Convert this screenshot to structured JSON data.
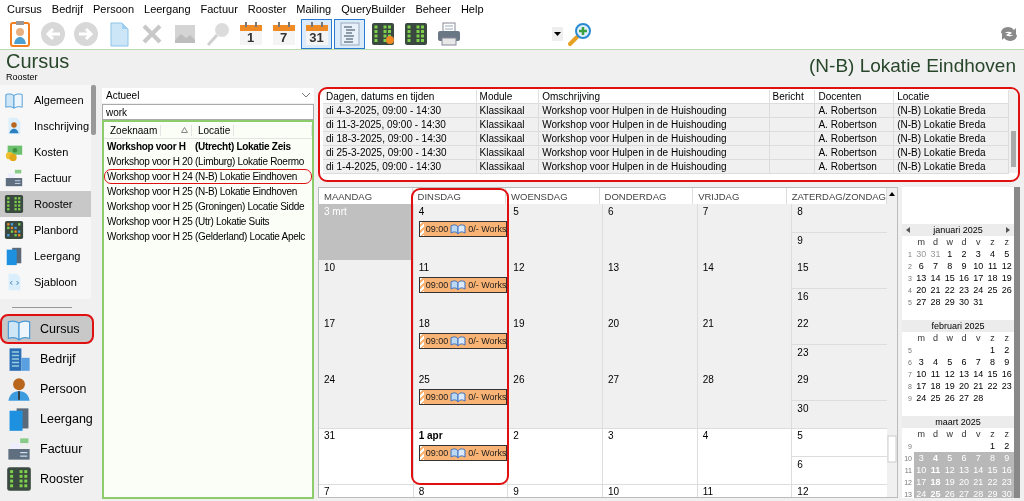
{
  "menu": [
    "Cursus",
    "Bedrijf",
    "Persoon",
    "Leergang",
    "Factuur",
    "Rooster",
    "Mailing",
    "QueryBuilder",
    "Beheer",
    "Help"
  ],
  "toolbar": [
    {
      "kind": "person",
      "disabled": false,
      "selected": false
    },
    {
      "kind": "back",
      "disabled": true,
      "selected": false
    },
    {
      "kind": "forward",
      "disabled": true,
      "selected": false
    },
    {
      "kind": "document",
      "disabled": false,
      "selected": false
    },
    {
      "kind": "delete",
      "disabled": true,
      "selected": false
    },
    {
      "kind": "picture",
      "disabled": true,
      "selected": false
    },
    {
      "kind": "pin",
      "disabled": true,
      "selected": false
    },
    {
      "kind": "calendar",
      "label": "1",
      "disabled": false,
      "selected": false
    },
    {
      "kind": "calendar",
      "label": "7",
      "disabled": false,
      "selected": false
    },
    {
      "kind": "calendar",
      "label": "31",
      "disabled": false,
      "selected": true
    },
    {
      "kind": "list",
      "disabled": false,
      "selected": true
    },
    {
      "kind": "grid-dot",
      "disabled": false,
      "selected": false
    },
    {
      "kind": "grid",
      "disabled": false,
      "selected": false
    },
    {
      "kind": "printer",
      "disabled": false,
      "selected": false
    }
  ],
  "header": {
    "title": "Cursus",
    "subtitle": "Rooster",
    "location": "(N-B) Lokatie Eindhoven"
  },
  "sidebar": {
    "sections": [
      {
        "label": "Algemeen",
        "kind": "book",
        "selected": false
      },
      {
        "label": "Inschrijving",
        "kind": "person-doc",
        "selected": false
      },
      {
        "label": "Kosten",
        "kind": "money",
        "selected": false
      },
      {
        "label": "Factuur",
        "kind": "register",
        "selected": false
      },
      {
        "label": "Rooster",
        "kind": "grid",
        "selected": true
      },
      {
        "label": "Planbord",
        "kind": "board",
        "selected": false
      },
      {
        "label": "Leergang",
        "kind": "panels",
        "selected": false
      },
      {
        "label": "Sjabloon",
        "kind": "code",
        "selected": false
      }
    ],
    "modules": [
      {
        "label": "Cursus",
        "kind": "book",
        "selected": true,
        "highlighted": true
      },
      {
        "label": "Bedrijf",
        "kind": "building",
        "selected": false,
        "highlighted": false
      },
      {
        "label": "Persoon",
        "kind": "person",
        "selected": false,
        "highlighted": false
      },
      {
        "label": "Leergang",
        "kind": "panels",
        "selected": false,
        "highlighted": false
      },
      {
        "label": "Factuur",
        "kind": "register",
        "selected": false,
        "highlighted": false
      },
      {
        "label": "Rooster",
        "kind": "grid",
        "selected": false,
        "highlighted": false
      }
    ]
  },
  "search_list": {
    "filter": "Actueel",
    "search": "work",
    "columns": [
      "Zoeknaam",
      "Locatie"
    ],
    "rows": [
      {
        "name": "Workshop voor H",
        "location": "(Utrecht) Lokatie Zeis",
        "bold": true,
        "highlighted": false
      },
      {
        "name": "Workshop voor H 20",
        "location": "(Limburg) Lokatie Roermo",
        "bold": false,
        "highlighted": false
      },
      {
        "name": "Workshop voor H 24",
        "location": "(N-B) Lokatie Eindhoven",
        "bold": false,
        "highlighted": true
      },
      {
        "name": "Workshop voor H 25",
        "location": "(N-B) Lokatie Eindhoven",
        "bold": false,
        "highlighted": false
      },
      {
        "name": "Workshop voor H 25",
        "location": "(Groningen) Locatie Sidde",
        "bold": false,
        "highlighted": false
      },
      {
        "name": "Workshop voor H 25",
        "location": "(Utr) Lokatie Suits",
        "bold": false,
        "highlighted": false
      },
      {
        "name": "Workshop voor H 25",
        "location": "(Gelderland) Locatie Apelc",
        "bold": false,
        "highlighted": false
      }
    ]
  },
  "table": {
    "highlighted": true,
    "columns": [
      "Dagen, datums en tijden",
      "Module",
      "Omschrijving",
      "Bericht",
      "Docenten",
      "Locatie"
    ],
    "rows": [
      {
        "dates": "di 4-3-2025, 09:00 - 14:30",
        "module": "Klassikaal",
        "description": "Workshop voor Hulpen in de Huishouding",
        "teacher": "A. Robertson",
        "location": "(N-B) Lokatie Breda"
      },
      {
        "dates": "di 11-3-2025, 09:00 - 14:30",
        "module": "Klassikaal",
        "description": "Workshop voor Hulpen in de Huishouding",
        "teacher": "A. Robertson",
        "location": "(N-B) Lokatie Breda"
      },
      {
        "dates": "di 18-3-2025, 09:00 - 14:30",
        "module": "Klassikaal",
        "description": "Workshop voor Hulpen in de Huishouding",
        "teacher": "A. Robertson",
        "location": "(N-B) Lokatie Breda"
      },
      {
        "dates": "di 25-3-2025, 09:00 - 14:30",
        "module": "Klassikaal",
        "description": "Workshop voor Hulpen in de Huishouding",
        "teacher": "A. Robertson",
        "location": "(N-B) Lokatie Breda"
      },
      {
        "dates": "di 1-4-2025, 09:00 - 14:30",
        "module": "Klassikaal",
        "description": "Workshop voor Hulpen in de Huishouding",
        "teacher": "A. Robertson",
        "location": "(N-B) Lokatie Breda"
      }
    ]
  },
  "calendar": {
    "weekdays": [
      {
        "label": "MAANDAG",
        "highlighted": false
      },
      {
        "label": "DINSDAG",
        "highlighted": true
      },
      {
        "label": "WOENSDAG",
        "highlighted": false
      },
      {
        "label": "DONDERDAG",
        "highlighted": false
      },
      {
        "label": "VRIJDAG",
        "highlighted": false
      },
      {
        "label": "ZATERDAG/ZONDAG",
        "highlighted": false
      }
    ],
    "weeks": [
      {
        "shaded": true,
        "days": [
          {
            "label": "3 mrt",
            "muted": true,
            "bold": false
          },
          {
            "label": "4",
            "muted": false,
            "bold": false,
            "events": [
              {
                "time": "09:00",
                "text": "0/- Works"
              }
            ]
          },
          {
            "label": "5",
            "muted": false,
            "bold": false
          },
          {
            "label": "6",
            "muted": false,
            "bold": false
          },
          {
            "label": "7",
            "muted": false,
            "bold": false
          }
        ],
        "weekend": [
          "8",
          "9"
        ]
      },
      {
        "shaded": true,
        "days": [
          {
            "label": "10",
            "muted": false,
            "bold": false
          },
          {
            "label": "11",
            "muted": false,
            "bold": false,
            "events": [
              {
                "time": "09:00",
                "text": "0/- Works"
              }
            ]
          },
          {
            "label": "12",
            "muted": false,
            "bold": false
          },
          {
            "label": "13",
            "muted": false,
            "bold": false
          },
          {
            "label": "14",
            "muted": false,
            "bold": false
          }
        ],
        "weekend": [
          "15",
          "16"
        ]
      },
      {
        "shaded": true,
        "days": [
          {
            "label": "17",
            "muted": false,
            "bold": false
          },
          {
            "label": "18",
            "muted": false,
            "bold": false,
            "events": [
              {
                "time": "09:00",
                "text": "0/- Works"
              }
            ]
          },
          {
            "label": "19",
            "muted": false,
            "bold": false
          },
          {
            "label": "20",
            "muted": false,
            "bold": false
          },
          {
            "label": "21",
            "muted": false,
            "bold": false
          }
        ],
        "weekend": [
          "22",
          "23"
        ]
      },
      {
        "shaded": true,
        "days": [
          {
            "label": "24",
            "muted": false,
            "bold": false
          },
          {
            "label": "25",
            "muted": false,
            "bold": false,
            "events": [
              {
                "time": "09:00",
                "text": "0/- Works"
              }
            ]
          },
          {
            "label": "26",
            "muted": false,
            "bold": false
          },
          {
            "label": "27",
            "muted": false,
            "bold": false
          },
          {
            "label": "28",
            "muted": false,
            "bold": false
          }
        ],
        "weekend": [
          "29",
          "30"
        ]
      },
      {
        "shaded": false,
        "days": [
          {
            "label": "31",
            "muted": false,
            "bold": false
          },
          {
            "label": "1 apr",
            "muted": false,
            "bold": true,
            "events": [
              {
                "time": "09:00",
                "text": "0/- Works"
              }
            ]
          },
          {
            "label": "2",
            "muted": false,
            "bold": false
          },
          {
            "label": "3",
            "muted": false,
            "bold": false
          },
          {
            "label": "4",
            "muted": false,
            "bold": false
          }
        ],
        "weekend": [
          "5",
          "6"
        ]
      },
      {
        "shaded": false,
        "days": [
          {
            "label": "7",
            "muted": false,
            "bold": false
          },
          {
            "label": "8",
            "muted": false,
            "bold": false
          },
          {
            "label": "9",
            "muted": false,
            "bold": false
          },
          {
            "label": "10",
            "muted": false,
            "bold": false
          },
          {
            "label": "11",
            "muted": false,
            "bold": false
          }
        ],
        "weekend": [
          "12"
        ]
      }
    ]
  },
  "mini_calendar": {
    "months": [
      {
        "title": "januari 2025",
        "arrows": true,
        "weekdays": [
          "m",
          "d",
          "w",
          "d",
          "v",
          "z",
          "z"
        ],
        "weeks": [
          {
            "number": "1",
            "selected": false,
            "days": [
              {
                "day": "30",
                "muted": true,
                "bold": false
              },
              {
                "day": "31",
                "muted": true,
                "bold": false
              },
              {
                "day": "1",
                "muted": false,
                "bold": false
              },
              {
                "day": "2",
                "muted": false,
                "bold": false
              },
              {
                "day": "3",
                "muted": false,
                "bold": false
              },
              {
                "day": "4",
                "muted": false,
                "bold": false
              },
              {
                "day": "5",
                "muted": false,
                "bold": false
              }
            ]
          },
          {
            "number": "2",
            "selected": false,
            "days": [
              {
                "day": "6",
                "muted": false,
                "bold": false
              },
              {
                "day": "7",
                "muted": false,
                "bold": false
              },
              {
                "day": "8",
                "muted": false,
                "bold": false
              },
              {
                "day": "9",
                "muted": false,
                "bold": false
              },
              {
                "day": "10",
                "muted": false,
                "bold": false
              },
              {
                "day": "11",
                "muted": false,
                "bold": false
              },
              {
                "day": "12",
                "muted": false,
                "bold": false
              }
            ]
          },
          {
            "number": "3",
            "selected": false,
            "days": [
              {
                "day": "13",
                "muted": false,
                "bold": false
              },
              {
                "day": "14",
                "muted": false,
                "bold": false
              },
              {
                "day": "15",
                "muted": false,
                "bold": false
              },
              {
                "day": "16",
                "muted": false,
                "bold": false
              },
              {
                "day": "17",
                "muted": false,
                "bold": false
              },
              {
                "day": "18",
                "muted": false,
                "bold": false
              },
              {
                "day": "19",
                "muted": false,
                "bold": false
              }
            ]
          },
          {
            "number": "4",
            "selected": false,
            "days": [
              {
                "day": "20",
                "muted": false,
                "bold": false
              },
              {
                "day": "21",
                "muted": false,
                "bold": false
              },
              {
                "day": "22",
                "muted": false,
                "bold": false
              },
              {
                "day": "23",
                "muted": false,
                "bold": false
              },
              {
                "day": "24",
                "muted": false,
                "bold": false
              },
              {
                "day": "25",
                "muted": false,
                "bold": false
              },
              {
                "day": "26",
                "muted": false,
                "bold": false
              }
            ]
          },
          {
            "number": "5",
            "selected": false,
            "days": [
              {
                "day": "27",
                "muted": false,
                "bold": false
              },
              {
                "day": "28",
                "muted": false,
                "bold": false
              },
              {
                "day": "29",
                "muted": false,
                "bold": false
              },
              {
                "day": "30",
                "muted": false,
                "bold": false
              },
              {
                "day": "31",
                "muted": false,
                "bold": false
              }
            ]
          }
        ]
      },
      {
        "title": "februari 2025",
        "arrows": false,
        "weekdays": [
          "m",
          "d",
          "w",
          "d",
          "v",
          "z",
          "z"
        ],
        "weeks": [
          {
            "number": "5",
            "selected": false,
            "days": [
              {
                "day": "1",
                "muted": false,
                "bold": false
              },
              {
                "day": "2",
                "muted": false,
                "bold": false
              }
            ]
          },
          {
            "number": "6",
            "selected": false,
            "days": [
              {
                "day": "3",
                "muted": false,
                "bold": false
              },
              {
                "day": "4",
                "muted": false,
                "bold": false
              },
              {
                "day": "5",
                "muted": false,
                "bold": false
              },
              {
                "day": "6",
                "muted": false,
                "bold": false
              },
              {
                "day": "7",
                "muted": false,
                "bold": false
              },
              {
                "day": "8",
                "muted": false,
                "bold": false
              },
              {
                "day": "9",
                "muted": false,
                "bold": false
              }
            ]
          },
          {
            "number": "7",
            "selected": false,
            "days": [
              {
                "day": "10",
                "muted": false,
                "bold": false
              },
              {
                "day": "11",
                "muted": false,
                "bold": false
              },
              {
                "day": "12",
                "muted": false,
                "bold": false
              },
              {
                "day": "13",
                "muted": false,
                "bold": false
              },
              {
                "day": "14",
                "muted": false,
                "bold": false
              },
              {
                "day": "15",
                "muted": false,
                "bold": false
              },
              {
                "day": "16",
                "muted": false,
                "bold": false
              }
            ]
          },
          {
            "number": "8",
            "selected": false,
            "days": [
              {
                "day": "17",
                "muted": false,
                "bold": false
              },
              {
                "day": "18",
                "muted": false,
                "bold": false
              },
              {
                "day": "19",
                "muted": false,
                "bold": false
              },
              {
                "day": "20",
                "muted": false,
                "bold": false
              },
              {
                "day": "21",
                "muted": false,
                "bold": false
              },
              {
                "day": "22",
                "muted": false,
                "bold": false
              },
              {
                "day": "23",
                "muted": false,
                "bold": false
              }
            ]
          },
          {
            "number": "9",
            "selected": false,
            "days": [
              {
                "day": "24",
                "muted": false,
                "bold": false
              },
              {
                "day": "25",
                "muted": false,
                "bold": false
              },
              {
                "day": "26",
                "muted": false,
                "bold": false
              },
              {
                "day": "27",
                "muted": false,
                "bold": false
              },
              {
                "day": "28",
                "muted": false,
                "bold": false
              }
            ]
          }
        ]
      },
      {
        "title": "maart 2025",
        "arrows": false,
        "weekdays": [
          "m",
          "d",
          "w",
          "d",
          "v",
          "z",
          "z"
        ],
        "weeks": [
          {
            "number": "9",
            "selected": false,
            "days": [
              {
                "day": "1",
                "muted": false,
                "bold": false
              },
              {
                "day": "2",
                "muted": false,
                "bold": false
              }
            ]
          },
          {
            "number": "10",
            "selected": true,
            "days": [
              {
                "day": "3",
                "muted": false,
                "bold": false
              },
              {
                "day": "4",
                "muted": false,
                "bold": true
              },
              {
                "day": "5",
                "muted": false,
                "bold": false
              },
              {
                "day": "6",
                "muted": false,
                "bold": false
              },
              {
                "day": "7",
                "muted": false,
                "bold": false
              },
              {
                "day": "8",
                "muted": false,
                "bold": false
              },
              {
                "day": "9",
                "muted": false,
                "bold": false
              }
            ]
          },
          {
            "number": "11",
            "selected": true,
            "days": [
              {
                "day": "10",
                "muted": false,
                "bold": false
              },
              {
                "day": "11",
                "muted": false,
                "bold": true
              },
              {
                "day": "12",
                "muted": false,
                "bold": false
              },
              {
                "day": "13",
                "muted": false,
                "bold": false
              },
              {
                "day": "14",
                "muted": false,
                "bold": false
              },
              {
                "day": "15",
                "muted": false,
                "bold": false
              },
              {
                "day": "16",
                "muted": false,
                "bold": false
              }
            ]
          },
          {
            "number": "12",
            "selected": true,
            "days": [
              {
                "day": "17",
                "muted": false,
                "bold": false
              },
              {
                "day": "18",
                "muted": false,
                "bold": true
              },
              {
                "day": "19",
                "muted": false,
                "bold": false
              },
              {
                "day": "20",
                "muted": false,
                "bold": false
              },
              {
                "day": "21",
                "muted": false,
                "bold": false
              },
              {
                "day": "22",
                "muted": false,
                "bold": false
              },
              {
                "day": "23",
                "muted": false,
                "bold": false
              }
            ]
          },
          {
            "number": "13",
            "selected": true,
            "days": [
              {
                "day": "24",
                "muted": false,
                "bold": false
              },
              {
                "day": "25",
                "muted": false,
                "bold": true
              },
              {
                "day": "26",
                "muted": false,
                "bold": false
              },
              {
                "day": "27",
                "muted": false,
                "bold": false
              },
              {
                "day": "28",
                "muted": false,
                "bold": false
              },
              {
                "day": "29",
                "muted": false,
                "bold": false
              },
              {
                "day": "30",
                "muted": false,
                "bold": false
              }
            ]
          }
        ]
      }
    ]
  }
}
